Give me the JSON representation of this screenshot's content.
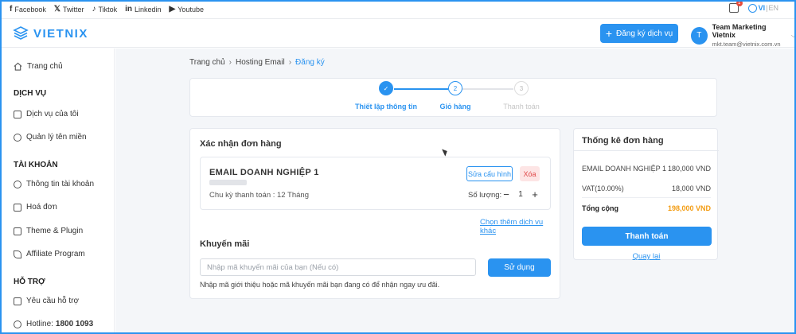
{
  "social": [
    {
      "icon": "f",
      "label": "Facebook"
    },
    {
      "icon": "𝕏",
      "label": "Twitter"
    },
    {
      "icon": "♪",
      "label": "Tiktok"
    },
    {
      "icon": "in",
      "label": "Linkedin"
    },
    {
      "icon": "▶",
      "label": "Youtube"
    }
  ],
  "topbar": {
    "cart_count": "1",
    "lang_vi": "VI",
    "lang_sep": "|",
    "lang_en": "EN"
  },
  "header": {
    "logo_text": "VIETNIX",
    "register_label": "Đăng ký dịch vụ",
    "user_initial": "T",
    "user_name": "Team Marketing Vietnix",
    "user_email": "mkt.team@vietnix.com.vn"
  },
  "sidebar": {
    "home": "Trang chủ",
    "section_services": "DỊCH VỤ",
    "my_services": "Dịch vụ của tôi",
    "domains": "Quản lý tên miền",
    "section_account": "TÀI KHOẢN",
    "account_info": "Thông tin tài khoản",
    "invoices": "Hoá đơn",
    "themes": "Theme & Plugin",
    "affiliate": "Affiliate Program",
    "section_support": "HỖ TRỢ",
    "support_request": "Yêu cầu hỗ trợ",
    "hotline_label": "Hotline:",
    "hotline_number": "1800 1093"
  },
  "breadcrumb": {
    "home": "Trang chủ",
    "hosting": "Hosting Email",
    "current": "Đăng ký"
  },
  "steps": [
    {
      "num": "✓",
      "label": "Thiết lập thông tin"
    },
    {
      "num": "2",
      "label": "Giỏ hàng"
    },
    {
      "num": "3",
      "label": "Thanh toán"
    }
  ],
  "order": {
    "title": "Xác nhận đơn hàng",
    "item_name": "EMAIL DOANH NGHIỆP 1",
    "cycle": "Chu kỳ thanh toán : 12 Tháng",
    "edit_label": "Sửa cấu hình",
    "delete_label": "Xóa",
    "qty_label": "Số lượng:",
    "qty_minus": "−",
    "qty_value": "1",
    "qty_plus": "+",
    "more_link": "Chọn thêm dịch vụ khác",
    "promo_title": "Khuyến mãi",
    "promo_placeholder": "Nhập mã khuyến mãi của bạn (Nếu có)",
    "promo_button": "Sử dụng",
    "promo_note": "Nhập mã giới thiệu hoặc mã khuyến mãi bạn đang có để nhận ngay ưu đãi."
  },
  "summary": {
    "title": "Thống kê đơn hàng",
    "rows": [
      {
        "label": "EMAIL DOANH NGHIỆP 1",
        "value": "180,000 VND"
      },
      {
        "label": "VAT(10.00%)",
        "value": "18,000 VND"
      }
    ],
    "total_label": "Tổng cộng",
    "total_value": "198,000 VND",
    "pay_button": "Thanh toán",
    "back_link": "Quay lại"
  }
}
